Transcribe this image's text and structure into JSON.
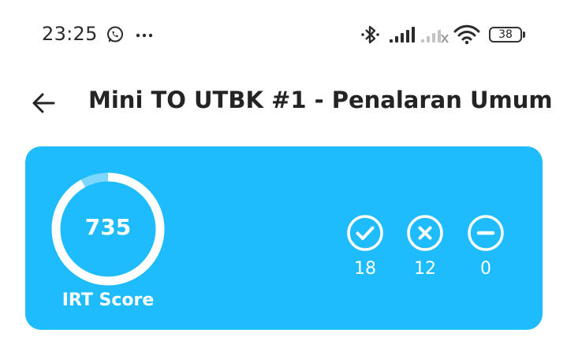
{
  "status_bar": {
    "time": "23:25",
    "battery": "38",
    "icons": [
      "whatsapp-icon",
      "more-dots-icon",
      "bluetooth-icon",
      "signal-icon",
      "signal-no-service-icon",
      "wifi-icon",
      "battery-icon"
    ]
  },
  "header": {
    "back_icon": "arrow-left-icon",
    "title": "Mini TO UTBK #1 - Penalaran Umum"
  },
  "score_card": {
    "background_color": "#1ebcfc",
    "score": "735",
    "score_label": "IRT Score",
    "score_progress": 0.92,
    "stats": {
      "correct": {
        "icon": "check-circle-icon",
        "count": "18"
      },
      "wrong": {
        "icon": "x-circle-icon",
        "count": "12"
      },
      "empty": {
        "icon": "minus-circle-icon",
        "count": "0"
      }
    }
  }
}
